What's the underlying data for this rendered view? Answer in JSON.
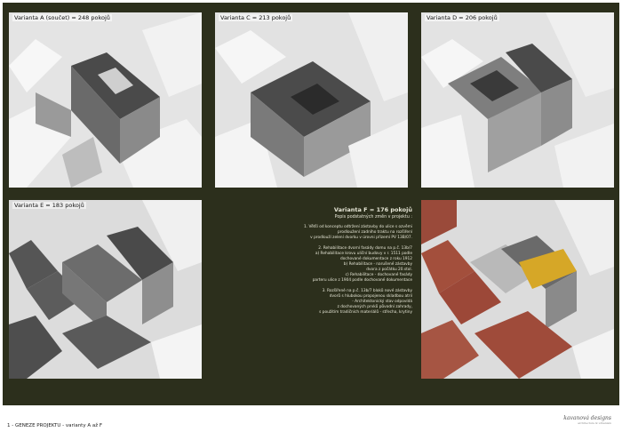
{
  "panels": [
    {
      "label": "Varianta A (součet) = 248 pokojů"
    },
    {
      "label": "Varianta C = 213 pokojů"
    },
    {
      "label": "Varianta D = 206 pokojů"
    },
    {
      "label": "Varianta E = 183 pokojů"
    },
    {
      "label": ""
    },
    {
      "label": ""
    }
  ],
  "text_block": {
    "title": "Varianta F = 176 pokojů",
    "subtitle": "Popis podstatných změn v projektu :",
    "paragraphs": [
      [
        "1. Větší od konceptu odtržení zástavby do ulice s ozvěmi",
        "prodloužení zadního traktu na rozšíření",
        "v prodlouží zelení dvorku v úrovni přízemí PV 13B/07."
      ],
      [
        "2. Rehabilitace dvorní fasády domu na p.č. 13b/7",
        "a) Rehabilitace krovu uliční budovy v r. 1511 podle",
        "dochované dokumentace z roku 1912",
        "b) Rehabilitace - narušené zástavby",
        "dvora z počátku 20.stol.",
        "c) Rehabilitace - dochované fasády",
        "parteru ulice z 1904 podle dochované dokumentace"
      ],
      [
        "3. Rozšířené na p.č. 13b/7 bloků nové zástavby",
        "dvorů s hlubokou propojenou skladbou atrií",
        "- Architektonický stav odpovídá",
        "z dochovaných prvků původní zahrady,",
        "s použitím tradičních materiálů - střecha, krytiny"
      ]
    ]
  },
  "footer": {
    "caption": "1 - GENEZE PROJEKTU - varianty A až F",
    "logo": "kavanová designs",
    "logo_sub": "architecture & urbanism"
  }
}
